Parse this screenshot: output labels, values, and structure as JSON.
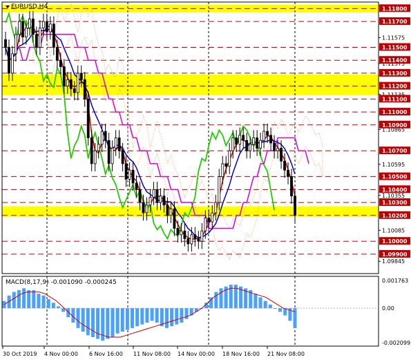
{
  "symbol_title": "EURUSD,H4",
  "indicator_title": "MACD(8,17,9) -0.001090 -0.000245",
  "colors": {
    "background": "#ffffff",
    "grid": "#000000",
    "dashed_red": "#c00000",
    "yellow_band": "#ffff00",
    "red_label": "#c00000",
    "tenkan": "#cc0000",
    "kijun": "#0000cc",
    "chikou": "#22cc00",
    "senkou_a": "#e8a070",
    "senkou_b": "#dd00dd",
    "macd_bar": "#4aa0ff",
    "macd_signal": "#cc0000"
  },
  "price_axis": {
    "min": 1.0975,
    "max": 1.1185,
    "plain_ticks": [
      "1.11575",
      "1.11375",
      "1.11135",
      "1.10865",
      "1.10595",
      "1.10355",
      "1.10085",
      "1.09845"
    ],
    "red_labels": [
      "1.11800",
      "1.11700",
      "1.11500",
      "1.11400",
      "1.11300",
      "1.11200",
      "1.11100",
      "1.11000",
      "1.10900",
      "1.10700",
      "1.10500",
      "1.10400",
      "1.10300",
      "1.10200",
      "1.10000",
      "1.09900"
    ]
  },
  "highlight_bands": [
    {
      "from": 1.1177,
      "to": 1.1183
    },
    {
      "from": 1.1113,
      "to": 1.1129
    },
    {
      "from": 1.1019,
      "to": 1.1027
    }
  ],
  "macd_axis": {
    "labels": [
      "0.001763",
      "0.00",
      "-0.002099"
    ],
    "max": 0.001763,
    "min": -0.002099
  },
  "time_axis": [
    "30 Oct 2019",
    "4 Nov 00:00",
    "6 Nov 16:00",
    "11 Nov 08:00",
    "14 Nov 00:00",
    "18 Nov 16:00",
    "21 Nov 08:00"
  ],
  "chart_data": {
    "type": "candlestick",
    "title": "EURUSD,H4",
    "price_range": [
      1.0975,
      1.1185
    ],
    "close": [
      1.115,
      1.113,
      1.1145,
      1.116,
      1.117,
      1.1158,
      1.1165,
      1.1172,
      1.116,
      1.115,
      1.1165,
      1.117,
      1.1162,
      1.1168,
      1.115,
      1.114,
      1.1135,
      1.112,
      1.1125,
      1.1118,
      1.1115,
      1.113,
      1.1125,
      1.111,
      1.108,
      1.106,
      1.107,
      1.1075,
      1.1085,
      1.1078,
      1.106,
      1.1072,
      1.108,
      1.107,
      1.106,
      1.1048,
      1.1055,
      1.1045,
      1.104,
      1.103,
      1.1022,
      1.1028,
      1.1034,
      1.104,
      1.103,
      1.1035,
      1.1028,
      1.102,
      1.1025,
      1.101,
      1.1005,
      1.1008,
      1.1002,
      1.0998,
      1.1005,
      1.1002,
      1.1,
      1.1008,
      1.1018,
      1.1015,
      1.1022,
      1.103,
      1.105,
      1.106,
      1.1058,
      1.107,
      1.108,
      1.1075,
      1.1082,
      1.1078,
      1.107,
      1.1075,
      1.108,
      1.1072,
      1.1078,
      1.1085,
      1.1082,
      1.1076,
      1.107,
      1.1072,
      1.1062,
      1.1055,
      1.105,
      1.1035,
      1.102
    ],
    "macd": {
      "main": [
        0.0004,
        0.0007,
        0.0009,
        0.001,
        0.0011,
        0.001,
        0.001,
        0.0008,
        0.0007,
        0.0005,
        0.0003,
        0.0001,
        -0.0002,
        -0.0005,
        -0.0008,
        -0.0011,
        -0.0013,
        -0.0015,
        -0.0016,
        -0.0017,
        -0.0018,
        -0.0017,
        -0.0016,
        -0.0014,
        -0.0013,
        -0.0012,
        -0.0011,
        -0.001,
        -0.0009,
        -0.0008,
        -0.0007,
        -0.0008,
        -0.001,
        -0.0011,
        -0.001,
        -0.0009,
        -0.0008,
        -0.0006,
        -0.0004,
        -0.0002,
        0.0,
        0.0003,
        0.0006,
        0.0009,
        0.0011,
        0.0012,
        0.0013,
        0.0013,
        0.0012,
        0.0011,
        0.001,
        0.0008,
        0.0006,
        0.0004,
        0.0002,
        0.0,
        -0.0002,
        -0.0004,
        -0.0007,
        -0.0011
      ],
      "signal": [
        0.0002,
        0.0004,
        0.0006,
        0.0008,
        0.0009,
        0.0009,
        0.0009,
        0.0008,
        0.0006,
        0.0004,
        0.0001,
        -0.0002,
        -0.0005,
        -0.0008,
        -0.001,
        -0.0012,
        -0.0014,
        -0.0015,
        -0.0016,
        -0.0016,
        -0.0016,
        -0.0015,
        -0.0014,
        -0.0013,
        -0.0012,
        -0.0011,
        -0.001,
        -0.0009,
        -0.0008,
        -0.0007,
        -0.0006,
        -0.0005,
        -0.0004,
        -0.0002,
        0.0,
        0.0003,
        0.0006,
        0.0008,
        0.001,
        0.0011,
        0.0011,
        0.001,
        0.0009,
        0.0008,
        0.0007,
        0.0006,
        0.0004,
        0.0002,
        0.0,
        -0.0001,
        -0.0002
      ]
    }
  }
}
